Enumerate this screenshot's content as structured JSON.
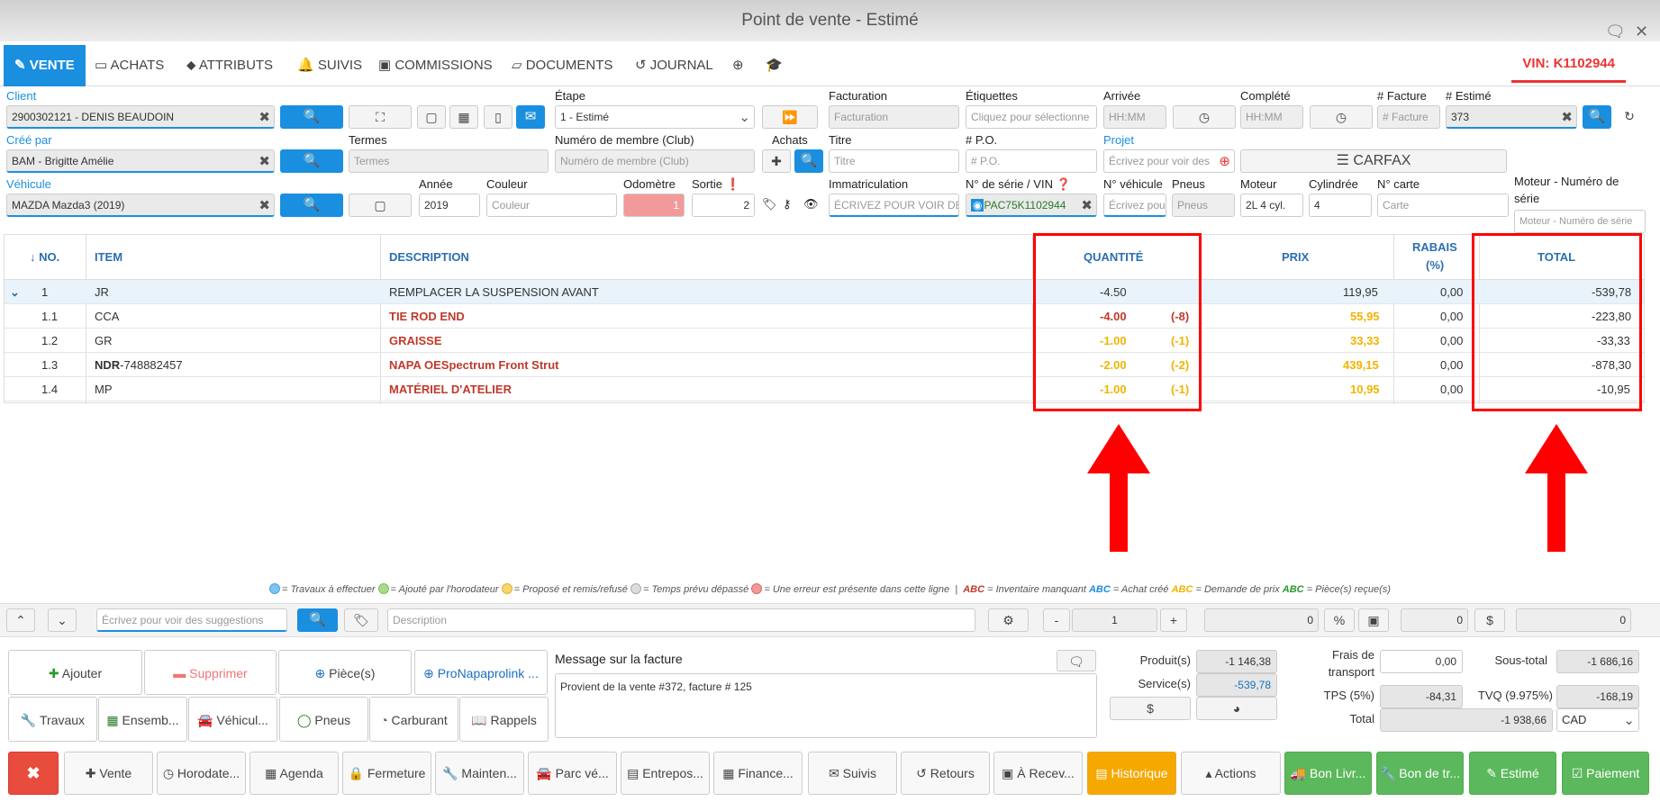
{
  "window": {
    "title": "Point de vente - Estimé"
  },
  "tabs": [
    {
      "label": "VENTE"
    },
    {
      "label": "ACHATS"
    },
    {
      "label": "ATTRIBUTS"
    },
    {
      "label": "SUIVIS"
    },
    {
      "label": "COMMISSIONS"
    },
    {
      "label": "DOCUMENTS"
    },
    {
      "label": "JOURNAL"
    }
  ],
  "vin_badge": "VIN: K1102944",
  "form": {
    "client_label": "Client",
    "client_value": "2900302121 - DENIS BEAUDOIN",
    "etape_label": "Étape",
    "etape_value": "1 - Estimé",
    "facturation_label": "Facturation",
    "facturation_ph": "Facturation",
    "etiquettes_label": "Étiquettes",
    "etiquettes_ph": "Cliquez pour sélectionne",
    "arrivee_label": "Arrivée",
    "arrivee_ph": "HH:MM",
    "complete_label": "Complété",
    "complete_ph": "HH:MM",
    "facture_label": "# Facture",
    "facture_ph": "# Facture",
    "estime_label": "# Estimé",
    "estime_value": "373",
    "cree_par_label": "Créé par",
    "cree_par_value": "BAM - Brigitte Amélie",
    "termes_label": "Termes",
    "termes_ph": "Termes",
    "membre_label": "Numéro de membre (Club)",
    "membre_ph": "Numéro de membre (Club)",
    "achats_label": "Achats",
    "titre_label": "Titre",
    "titre_ph": "Titre",
    "po_label": "# P.O.",
    "po_ph": "# P.O.",
    "projet_label": "Projet",
    "projet_ph": "Écrivez pour voir des",
    "carfax_label": "CARFAX",
    "vehicule_label": "Véhicule",
    "vehicule_value": "MAZDA Mazda3 (2019)",
    "annee_label": "Année",
    "annee_value": "2019",
    "couleur_label": "Couleur",
    "couleur_ph": "Couleur",
    "odometre_label": "Odomètre",
    "odometre_value": "1",
    "sortie_label": "Sortie",
    "sortie_value": "2",
    "immat_label": "Immatriculation",
    "immat_ph": "ÉCRIVEZ POUR VOIR DES",
    "serie_label": "N° de série / VIN",
    "serie_value": "PAC75K1102944",
    "nveh_label": "N° véhicule",
    "nveh_ph": "Écrivez pou",
    "pneus_label": "Pneus",
    "pneus_ph": "Pneus",
    "moteur_label": "Moteur",
    "moteur_value": "2L 4 cyl.",
    "cyl_label": "Cylindrée",
    "cyl_value": "4",
    "carte_label": "N° carte",
    "carte_ph": "Carte",
    "moteur_serie_label1": "Moteur - Numéro de",
    "moteur_serie_label2": "série",
    "moteur_serie_ph": "Moteur - Numéro de série"
  },
  "table": {
    "headers": {
      "no": "↓ NO.",
      "item": "ITEM",
      "description": "DESCRIPTION",
      "quantite": "QUANTITÉ",
      "prix": "PRIX",
      "rabais1": "RABAIS",
      "rabais2": "(%)",
      "total": "TOTAL"
    },
    "rows": [
      {
        "no": "1",
        "item": "JR",
        "item_extra": "",
        "description": "REMPLACER LA SUSPENSION AVANT",
        "qty": "-4.50",
        "qty2": "",
        "prix": "119,95",
        "rabais": "0,00",
        "total": "-539,78"
      },
      {
        "no": "1.1",
        "item": "CCA",
        "item_extra": "",
        "description": "TIE ROD END",
        "qty": "-4.00",
        "qty2": "(-8)",
        "prix": "55,95",
        "rabais": "0,00",
        "total": "-223,80"
      },
      {
        "no": "1.2",
        "item": "GR",
        "item_extra": "",
        "description": "GRAISSE",
        "qty": "-1.00",
        "qty2": "(-1)",
        "prix": "33,33",
        "rabais": "0,00",
        "total": "-33,33"
      },
      {
        "no": "1.3",
        "item": "NDR",
        "item_extra": "-748882457",
        "description": "NAPA OESpectrum Front Strut",
        "qty": "-2.00",
        "qty2": "(-2)",
        "prix": "439,15",
        "rabais": "0,00",
        "total": "-878,30"
      },
      {
        "no": "1.4",
        "item": "MP",
        "item_extra": "",
        "description": "MATÉRIEL D'ATELIER",
        "qty": "-1.00",
        "qty2": "(-1)",
        "prix": "10,95",
        "rabais": "0,00",
        "total": "-10,95"
      }
    ]
  },
  "legend": {
    "l1": "= Travaux à effectuer",
    "l2": "= Ajouté par l'horodateur",
    "l3": "= Proposé et remis/refusé",
    "l4": "= Temps prévu dépassé",
    "l5": "= Une erreur est présente dans cette ligne",
    "abc": "ABC",
    "a1": "= Inventaire manquant",
    "a2": "= Achat créé",
    "a3": "= Demande de prix",
    "a4": "= Pièce(s) reçue(s)"
  },
  "entry": {
    "suggest_ph": "Écrivez pour voir des suggestions",
    "desc_ph": "Description",
    "qty": "1",
    "v1": "0",
    "v2": "0",
    "v3": "0"
  },
  "actions": {
    "ajouter": "Ajouter",
    "supprimer": "Supprimer",
    "pieces": "Pièce(s)",
    "pronapa": "ProNapaprolink ...",
    "travaux": "Travaux",
    "ensemb": "Ensemb...",
    "vehicul": "Véhicul...",
    "pneus": "Pneus",
    "carburant": "Carburant",
    "rappels": "Rappels"
  },
  "message": {
    "label": "Message sur la facture",
    "text": "Provient de la vente #372, facture # 125"
  },
  "totals": {
    "produits_label": "Produit(s)",
    "produits": "-1 146,38",
    "services_label": "Service(s)",
    "services": "-539,78",
    "frais_label1": "Frais de",
    "frais_label2": "transport",
    "frais": "0,00",
    "tps_label": "TPS (5%)",
    "tps": "-84,31",
    "total_label": "Total",
    "total": "-1 938,66",
    "sous_total_label": "Sous-total",
    "sous_total": "-1 686,16",
    "tvq_label": "TVQ (9.975%)",
    "tvq": "-168,19",
    "currency": "CAD"
  },
  "bottom": [
    "Vente",
    "Horodate...",
    "Agenda",
    "Fermeture",
    "Mainten...",
    "Parc vé...",
    "Entrepos...",
    "Finance...",
    "Suivis",
    "Retours",
    "À Recev...",
    "Historique",
    "Actions",
    "Bon Livr...",
    "Bon de tr...",
    "Estimé",
    "Paiement"
  ],
  "colors": {
    "accent": "#1a8fe0",
    "red_text": "#c0392b",
    "yellow_text": "#f0b400",
    "highlight": "#ff0000"
  }
}
